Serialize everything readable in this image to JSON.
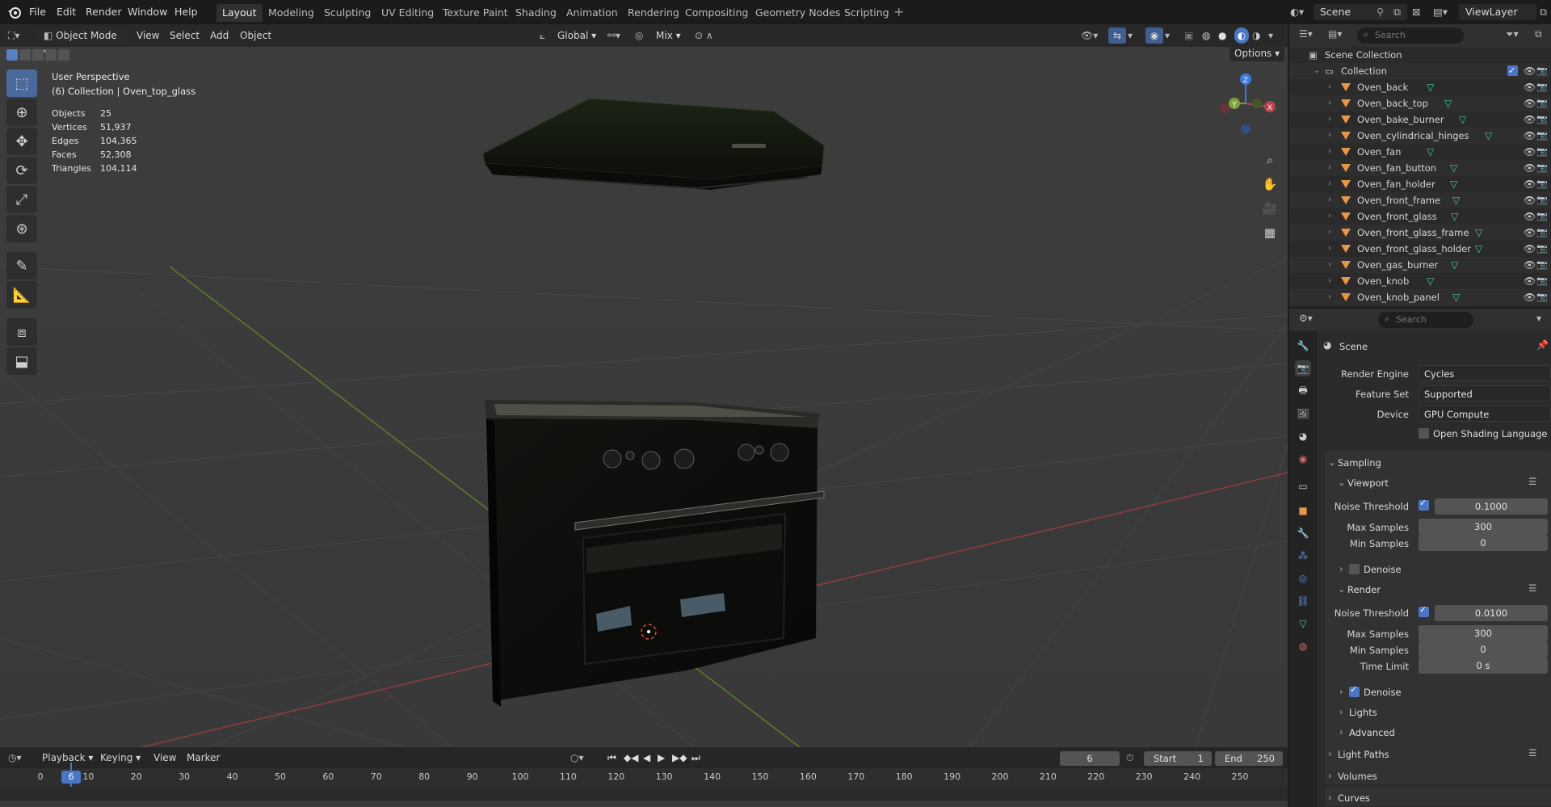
{
  "menu": {
    "items": [
      "File",
      "Edit",
      "Render",
      "Window",
      "Help"
    ],
    "workspaces": [
      "Layout",
      "Modeling",
      "Sculpting",
      "UV Editing",
      "Texture Paint",
      "Shading",
      "Animation",
      "Rendering",
      "Compositing",
      "Geometry Nodes",
      "Scripting"
    ],
    "active_workspace": "Layout",
    "scene": "Scene",
    "view_layer": "ViewLayer"
  },
  "viewport": {
    "mode": "Object Mode",
    "menus": [
      "View",
      "Select",
      "Add",
      "Object"
    ],
    "orientation": "Global",
    "snap_mix": "Mix",
    "options": "Options",
    "perspective": "User Perspective",
    "active": "(6) Collection | Oven_top_glass",
    "stats": [
      {
        "label": "Objects",
        "value": "25"
      },
      {
        "label": "Vertices",
        "value": "51,937"
      },
      {
        "label": "Edges",
        "value": "104,365"
      },
      {
        "label": "Faces",
        "value": "52,308"
      },
      {
        "label": "Triangles",
        "value": "104,114"
      }
    ],
    "gizmo": {
      "x": "X",
      "y": "Y",
      "z": "Z"
    }
  },
  "outliner": {
    "search_placeholder": "Search",
    "root": "Scene Collection",
    "collection": "Collection",
    "objects": [
      "Oven_back",
      "Oven_back_top",
      "Oven_bake_burner",
      "Oven_cylindrical_hinges",
      "Oven_fan",
      "Oven_fan_button",
      "Oven_fan_holder",
      "Oven_front_frame",
      "Oven_front_glass",
      "Oven_front_glass_frame",
      "Oven_front_glass_holder",
      "Oven_gas_burner",
      "Oven_knob",
      "Oven_knob_panel"
    ]
  },
  "properties": {
    "search_placeholder": "Search",
    "context": "Scene",
    "render_engine_label": "Render Engine",
    "render_engine": "Cycles",
    "feature_set_label": "Feature Set",
    "feature_set": "Supported",
    "device_label": "Device",
    "device": "GPU Compute",
    "osl": "Open Shading Language",
    "sampling": "Sampling",
    "viewport_section": "Viewport",
    "vp_noise_label": "Noise Threshold",
    "vp_noise": "0.1000",
    "vp_max_label": "Max Samples",
    "vp_max": "300",
    "vp_min_label": "Min Samples",
    "vp_min": "0",
    "vp_denoise": "Denoise",
    "render_section": "Render",
    "r_noise_label": "Noise Threshold",
    "r_noise": "0.0100",
    "r_max_label": "Max Samples",
    "r_max": "300",
    "r_min_label": "Min Samples",
    "r_min": "0",
    "r_time_label": "Time Limit",
    "r_time": "0 s",
    "r_denoise": "Denoise",
    "lights": "Lights",
    "advanced": "Advanced",
    "light_paths": "Light Paths",
    "volumes": "Volumes",
    "curves": "Curves"
  },
  "timeline": {
    "menus": [
      "Playback",
      "Keying",
      "View",
      "Marker"
    ],
    "current_frame": "6",
    "start_label": "Start",
    "start": "1",
    "end_label": "End",
    "end": "250",
    "ticks": [
      "0",
      "10",
      "20",
      "30",
      "40",
      "50",
      "60",
      "70",
      "80",
      "90",
      "100",
      "110",
      "120",
      "130",
      "140",
      "150",
      "160",
      "170",
      "180",
      "190",
      "200",
      "210",
      "220",
      "230",
      "240",
      "250"
    ]
  },
  "colors": {
    "accent": "#4a76c5",
    "object_icon": "#e69748",
    "mesh_icon": "#49c6b0",
    "x_axis": "#b8434b",
    "y_axis": "#7aa33a",
    "z_axis": "#3f7ae0"
  }
}
